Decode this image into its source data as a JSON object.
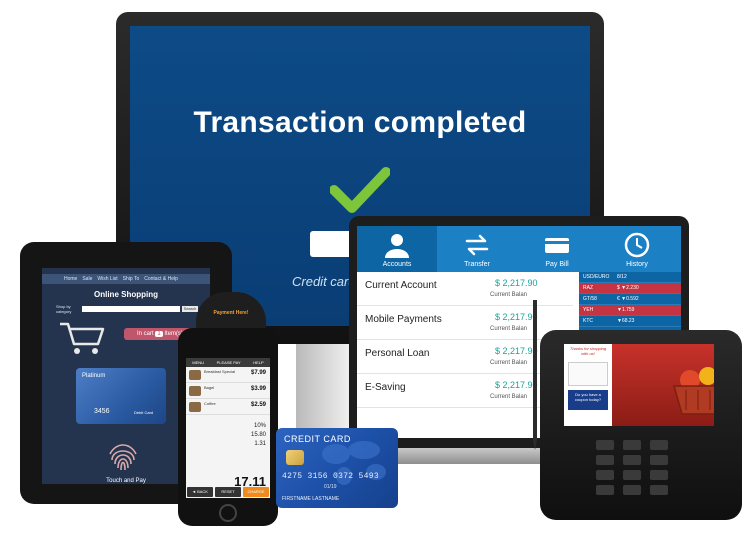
{
  "monitor": {
    "title": "Transaction completed",
    "input_value": "N",
    "caption": "Credit card a",
    "accent": "#7dc53a"
  },
  "tablet": {
    "nav": [
      "Home",
      "Sale",
      "Wish List",
      "Ship To",
      "Contact & Help"
    ],
    "title": "Online Shopping",
    "shop_by": "Shop by category",
    "search_button": "Search",
    "in_cart": "In cart",
    "in_cart_count": "1",
    "in_cart_suffix": "Item(s)",
    "card_name": "Platinum",
    "card_number": "3456",
    "card_type": "Debit Card",
    "touch_pay": "Touch and Pay"
  },
  "laptop": {
    "tabs": [
      {
        "label": "Accounts",
        "icon": "person-icon"
      },
      {
        "label": "Transfer",
        "icon": "transfer-icon"
      },
      {
        "label": "Pay Bill",
        "icon": "card-icon"
      },
      {
        "label": "History",
        "icon": "clock-icon"
      }
    ],
    "accounts": [
      {
        "label": "Current Account",
        "amount": "$ 2,217.90",
        "balance": "Current Balan"
      },
      {
        "label": "Mobile Payments",
        "amount": "$ 2,217.90",
        "balance": "Current Balan"
      },
      {
        "label": "Personal Loan",
        "amount": "$ 2,217.90",
        "balance": "Current Balan"
      },
      {
        "label": "E-Saving",
        "amount": "$ 2,217.90",
        "balance": "Current Balan"
      }
    ],
    "rates": [
      {
        "pair": "USD/EURO",
        "value": "8/12"
      },
      {
        "pair": "RAZ",
        "value": "$ ▼2.230"
      },
      {
        "pair": "GT/58",
        "value": "€ ▼0.592"
      },
      {
        "pair": "YEH",
        "value": "▼1.759"
      },
      {
        "pair": "KTC",
        "value": "▼68.23"
      }
    ]
  },
  "phone": {
    "reader_label": "Payment Here!",
    "toolbar": [
      "MENU",
      "PLEASE PAY",
      "HELP"
    ],
    "items": [
      {
        "name": "Breakfast Special",
        "price": "$7.99"
      },
      {
        "name": "Bagel",
        "price": "$3.99"
      },
      {
        "name": "Coffee",
        "price": "$2.59"
      }
    ],
    "discount": "10%",
    "subtotal": "15.80",
    "tax": "1.31",
    "total": "17.11",
    "buttons": [
      "◄ BACK",
      "RESET",
      "CHARGE"
    ]
  },
  "credit_card": {
    "title": "CREDIT CARD",
    "number": "4275 3156 0372 5493",
    "expiry": "01/19",
    "holder": "FIRSTNAME LASTNAME"
  },
  "pos": {
    "thanks": "Thanks for shopping with us!",
    "coupon": "Do you have a coupon today?"
  }
}
